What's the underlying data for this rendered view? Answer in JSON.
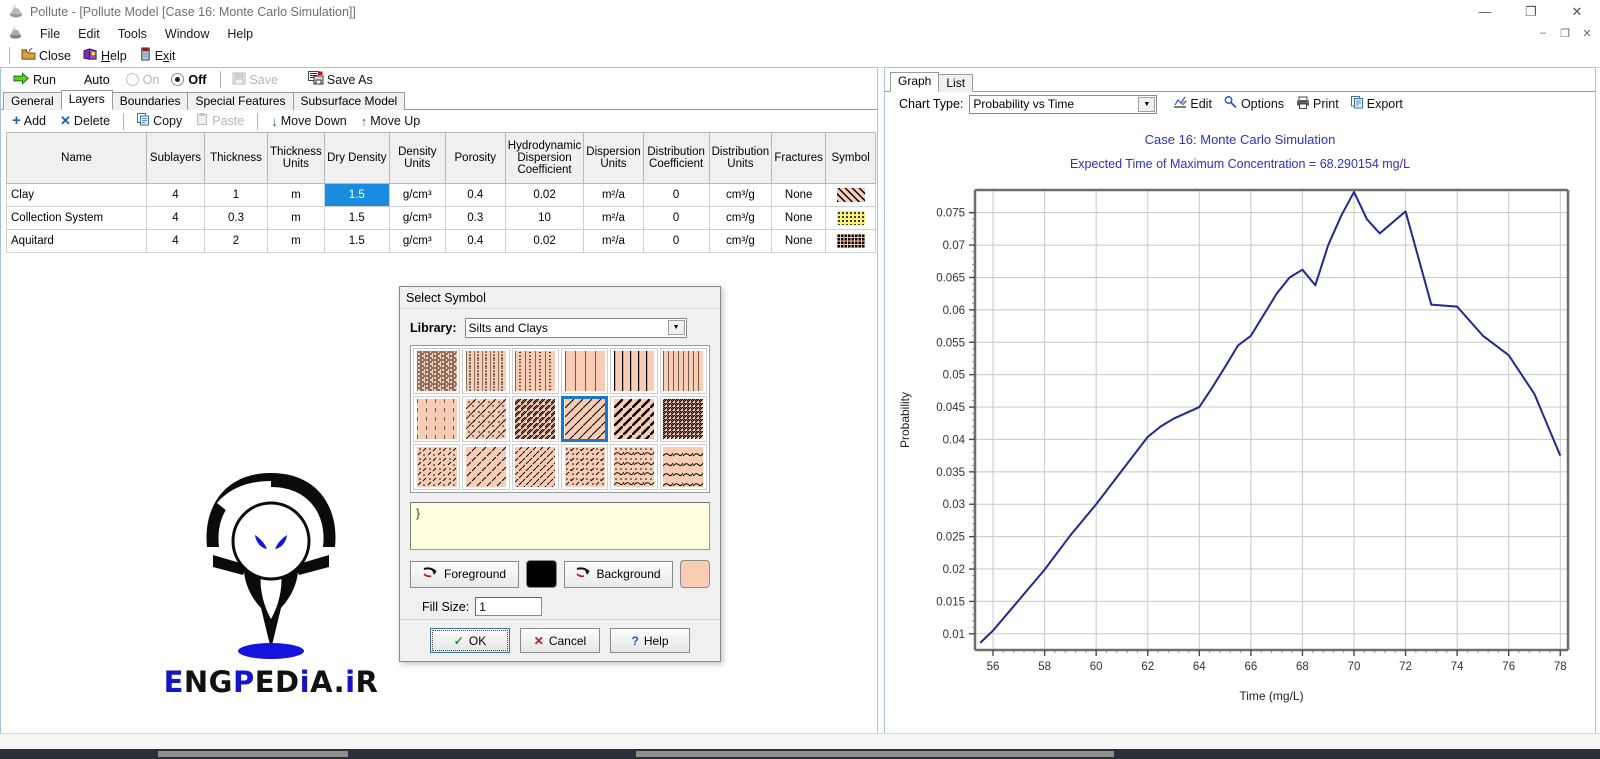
{
  "window": {
    "title": "Pollute - [Pollute Model [Case 16: Monte Carlo Simulation]]",
    "icon": "pollute-app-icon",
    "minimize": "—",
    "maximize": "❐",
    "close": "✕",
    "mdi_minimize": "–",
    "mdi_restore": "❐",
    "mdi_close": "✕"
  },
  "menu": {
    "icon": "pollute-doc-icon",
    "items": [
      {
        "label": "File"
      },
      {
        "label": "Edit"
      },
      {
        "label": "Tools"
      },
      {
        "label": "Window"
      },
      {
        "label": "Help"
      }
    ]
  },
  "toolbar_main": {
    "close": {
      "label": "Close",
      "icon": "folder-open-icon"
    },
    "help": {
      "label": "Help",
      "icon": "help-book-icon",
      "mnemonic": "H"
    },
    "exit": {
      "label": "Exit",
      "icon": "exit-door-icon",
      "mnemonic": "x"
    }
  },
  "toolbar_run": {
    "run": {
      "label": "Run",
      "icon": "green-arrow-icon"
    },
    "auto_label": "Auto",
    "auto_on": "On",
    "auto_off": "Off",
    "auto_selected": "Off",
    "save": {
      "label": "Save",
      "icon": "save-disk-icon",
      "enabled": false
    },
    "save_as": {
      "label": "Save As",
      "icon": "save-as-icon",
      "enabled": true
    }
  },
  "tabs": {
    "active": "Layers",
    "items": [
      {
        "label": "General"
      },
      {
        "label": "Layers"
      },
      {
        "label": "Boundaries"
      },
      {
        "label": "Special Features"
      },
      {
        "label": "Subsurface Model"
      }
    ]
  },
  "grid_toolbar": {
    "add": {
      "label": "Add",
      "icon": "plus-icon"
    },
    "delete": {
      "label": "Delete",
      "icon": "x-delete-icon"
    },
    "copy": {
      "label": "Copy",
      "icon": "copy-icon"
    },
    "paste": {
      "label": "Paste",
      "icon": "paste-icon",
      "enabled": false
    },
    "move_down": {
      "label": "Move Down",
      "icon": "arrow-down-icon"
    },
    "move_up": {
      "label": "Move Up",
      "icon": "arrow-up-icon"
    }
  },
  "layers_table": {
    "columns": [
      "Name",
      "Sublayers",
      "Thickness",
      "Thickness Units",
      "Dry Density",
      "Density Units",
      "Porosity",
      "Hydrodynamic Dispersion Coefficient",
      "Dispersion Units",
      "Distribution Coefficient",
      "Distribution Units",
      "Fractures",
      "Symbol"
    ],
    "rows": [
      {
        "name": "Clay",
        "sublayers": "4",
        "thickness": "1",
        "thickness_units": "m",
        "dry_density": "1.5",
        "density_units": "g/cm³",
        "porosity": "0.4",
        "hydro_disp_coeff": "0.02",
        "dispersion_units": "m²/a",
        "dist_coeff": "0",
        "dist_units": "cm³/g",
        "fractures": "None",
        "symbol": "diagonal-hatch-peach"
      },
      {
        "name": "Collection System",
        "sublayers": "4",
        "thickness": "0.3",
        "thickness_units": "m",
        "dry_density": "1.5",
        "density_units": "g/cm³",
        "porosity": "0.3",
        "hydro_disp_coeff": "10",
        "dispersion_units": "m²/a",
        "dist_coeff": "0",
        "dist_units": "cm³/g",
        "fractures": "None",
        "symbol": "dotted-yellow"
      },
      {
        "name": "Aquitard",
        "sublayers": "4",
        "thickness": "2",
        "thickness_units": "m",
        "dry_density": "1.5",
        "density_units": "g/cm³",
        "porosity": "0.4",
        "hydro_disp_coeff": "0.02",
        "dispersion_units": "m²/a",
        "dist_coeff": "0",
        "dist_units": "cm³/g",
        "fractures": "None",
        "symbol": "dense-dot-dark"
      }
    ],
    "selected_cell": {
      "row": 0,
      "column": "dry_density",
      "value": "1.5"
    }
  },
  "logo": {
    "text_parts": [
      {
        "t": "E",
        "c": "#1414c8"
      },
      {
        "t": "N",
        "c": "#111111"
      },
      {
        "t": "G",
        "c": "#111111"
      },
      {
        "t": "P",
        "c": "#1414c8"
      },
      {
        "t": "E",
        "c": "#111111"
      },
      {
        "t": "D",
        "c": "#111111"
      },
      {
        "t": "i",
        "c": "#1414c8"
      },
      {
        "t": "A",
        "c": "#111111"
      },
      {
        "t": ".",
        "c": "#111111"
      },
      {
        "t": "i",
        "c": "#1414c8"
      },
      {
        "t": "R",
        "c": "#111111"
      }
    ],
    "full_text": "ENGPEDiA.iR",
    "mark": "spider-logo"
  },
  "chart_panel": {
    "tabs": [
      {
        "label": "Graph",
        "active": true
      },
      {
        "label": "List",
        "active": false
      }
    ],
    "chart_type_label": "Chart Type:",
    "chart_type_value": "Probability vs Time",
    "chart_type_options": [
      "Probability vs Time"
    ],
    "buttons": [
      {
        "label": "Edit",
        "icon": "edit-chart-icon"
      },
      {
        "label": "Options",
        "icon": "options-wrench-icon"
      },
      {
        "label": "Print",
        "icon": "printer-icon"
      },
      {
        "label": "Export",
        "icon": "export-doc-icon"
      }
    ]
  },
  "chart_data": {
    "type": "line",
    "title": "Case 16: Monte Carlo Simulation",
    "subtitle": "Expected Time of Maximum Concentration = 68.290154 mg/L",
    "xlabel": "Time (mg/L)",
    "ylabel": "Probability",
    "xlim": [
      55.3,
      78.3
    ],
    "ylim": [
      0.0075,
      0.0785
    ],
    "xticks": [
      56,
      58,
      60,
      62,
      64,
      66,
      68,
      70,
      72,
      74,
      76,
      78
    ],
    "yticks": [
      0.01,
      0.015,
      0.02,
      0.025,
      0.03,
      0.035,
      0.04,
      0.045,
      0.05,
      0.055,
      0.06,
      0.065,
      0.07,
      0.075
    ],
    "grid": true,
    "legend": false,
    "line_color": "#1f2a8c",
    "series": [
      {
        "name": "Probability",
        "x": [
          55.5,
          56.0,
          57.0,
          58.0,
          59.0,
          60.0,
          61.0,
          62.0,
          62.5,
          63.0,
          64.0,
          64.5,
          65.0,
          65.5,
          66.0,
          67.0,
          67.5,
          68.0,
          68.5,
          69.0,
          69.5,
          70.0,
          70.5,
          71.0,
          72.0,
          73.0,
          74.0,
          75.0,
          76.0,
          77.0,
          78.0
        ],
        "y": [
          0.0086,
          0.0105,
          0.0152,
          0.0199,
          0.0252,
          0.03,
          0.0352,
          0.0404,
          0.042,
          0.0432,
          0.045,
          0.048,
          0.0512,
          0.0545,
          0.056,
          0.0625,
          0.065,
          0.0662,
          0.0638,
          0.07,
          0.0745,
          0.0782,
          0.074,
          0.0718,
          0.0752,
          0.0608,
          0.0605,
          0.056,
          0.053,
          0.047,
          0.0375,
          0.0305
        ]
      }
    ]
  },
  "dialog": {
    "title": "Select Symbol",
    "library_label": "Library:",
    "library_value": "Silts and Clays",
    "library_options": [
      "Silts and Clays"
    ],
    "description_value": "}",
    "foreground": {
      "label": "Foreground",
      "icon": "color-picker-icon",
      "color": "#000000"
    },
    "background": {
      "label": "Background",
      "icon": "color-picker-icon",
      "color": "#f9cdb4"
    },
    "fill_size_label": "Fill Size:",
    "fill_size_value": "1",
    "ok": {
      "label": "OK",
      "icon": "check-icon"
    },
    "cancel": {
      "label": "Cancel",
      "icon": "x-icon"
    },
    "help": {
      "label": "Help",
      "icon": "question-icon",
      "mnemonic": "H"
    },
    "selected_index": 9,
    "symbols": [
      {
        "id": "dense-dots-vlines"
      },
      {
        "id": "dots-vlines-sparse"
      },
      {
        "id": "dotted-vlines-wide"
      },
      {
        "id": "vlines-thin"
      },
      {
        "id": "vlines-thick"
      },
      {
        "id": "vlines-dense"
      },
      {
        "id": "dashed-vlines"
      },
      {
        "id": "diag-dots"
      },
      {
        "id": "diag-thin-dense"
      },
      {
        "id": "diag-thin-wide"
      },
      {
        "id": "diag-thick"
      },
      {
        "id": "diag-dense-dark"
      },
      {
        "id": "diag-dash-dots"
      },
      {
        "id": "diag-dash-wide"
      },
      {
        "id": "diag-dash-dense"
      },
      {
        "id": "diag-dash-dot-mix"
      },
      {
        "id": "wavy-dash"
      },
      {
        "id": "wavy-lines"
      }
    ]
  }
}
